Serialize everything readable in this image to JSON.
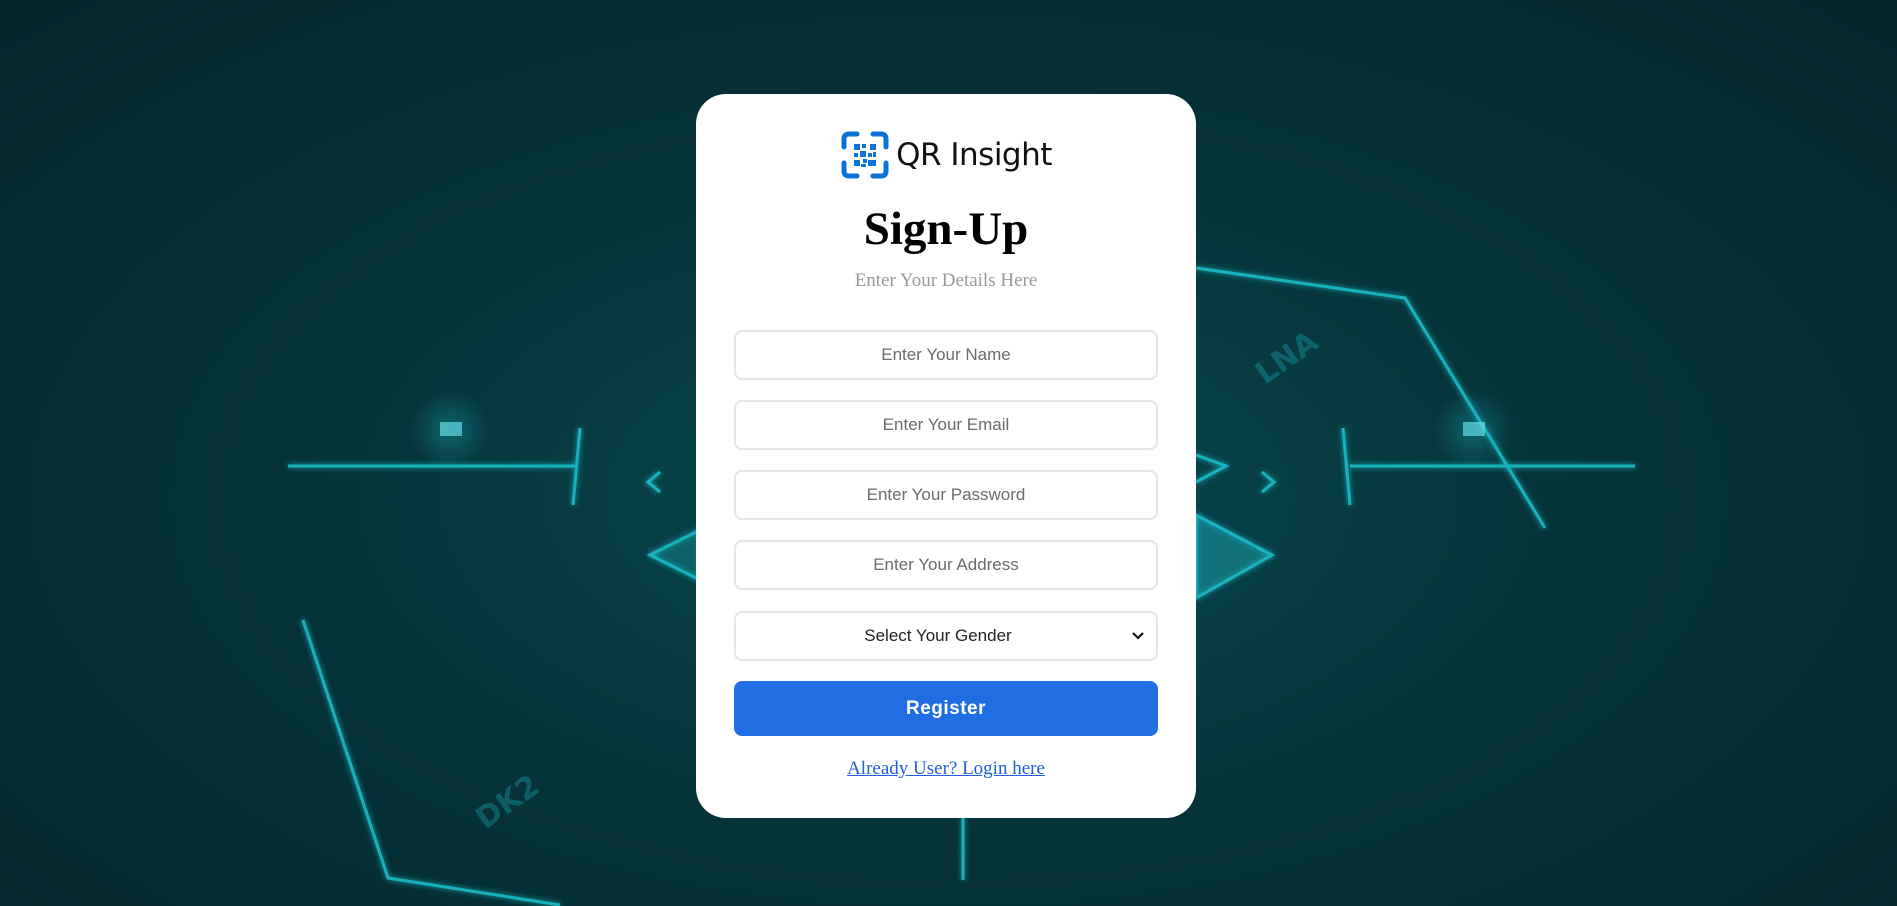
{
  "brand": {
    "name": "QR Insight",
    "logo_icon": "qr-scan-icon",
    "accent_color": "#0a72d6"
  },
  "form": {
    "title": "Sign-Up",
    "subtitle": "Enter Your Details Here",
    "name_placeholder": "Enter Your Name",
    "email_placeholder": "Enter Your Email",
    "password_placeholder": "Enter Your Password",
    "address_placeholder": "Enter Your Address",
    "gender_selected": "Select Your Gender",
    "register_label": "Register",
    "login_link": "Already User? Login here"
  },
  "colors": {
    "button": "#216de4",
    "link": "#1f5fd8",
    "background": "#06343b",
    "circuit": "#1fc7d4"
  }
}
